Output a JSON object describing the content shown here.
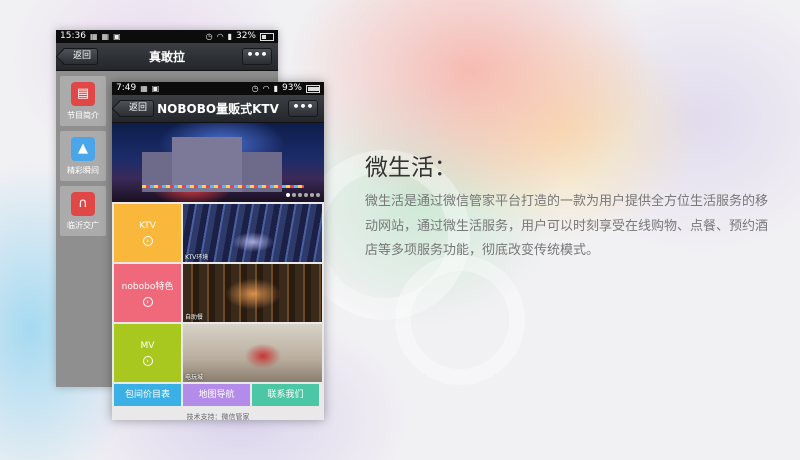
{
  "back_phone": {
    "status": {
      "time": "15:36",
      "battery": "32%"
    },
    "nav": {
      "back_label": "返回",
      "title": "真敢拉",
      "more_label": "•••"
    },
    "tiles": [
      {
        "label": "节目简介",
        "icon": "book-icon",
        "color": "#e04848"
      },
      {
        "label": "精彩瞬间",
        "icon": "image-icon",
        "color": "#4aa6e8"
      },
      {
        "label": "临沂交广",
        "icon": "headphones-icon",
        "color": "#e04848"
      }
    ]
  },
  "front_phone": {
    "status": {
      "time": "7:49",
      "battery": "93%"
    },
    "nav": {
      "back_label": "返回",
      "title": "NOBOBO量贩式KTV",
      "more_label": "•••"
    },
    "categories": [
      {
        "label": "KTV",
        "color": "#f9b83b",
        "photo_caption": "KTV环境"
      },
      {
        "label": "nobobo特色",
        "color": "#f0697a",
        "photo_caption": "自助餐"
      },
      {
        "label": "MV",
        "color": "#a9c81f",
        "photo_caption": "电玩城"
      }
    ],
    "footer_buttons": [
      {
        "label": "包间价目表",
        "color": "#3bb0e4"
      },
      {
        "label": "地图导航",
        "color": "#b38be8"
      },
      {
        "label": "联系我们",
        "color": "#4cc7a6"
      }
    ],
    "credit": "技术支持：微信管家"
  },
  "headline": "微生活：",
  "description": "微生活是通过微信管家平台打造的一款为用户提供全方位生活服务的移动网站，通过微生活服务，用户可以时刻享受在线购物、点餐、预约酒店等多项服务功能，彻底改变传统模式。"
}
